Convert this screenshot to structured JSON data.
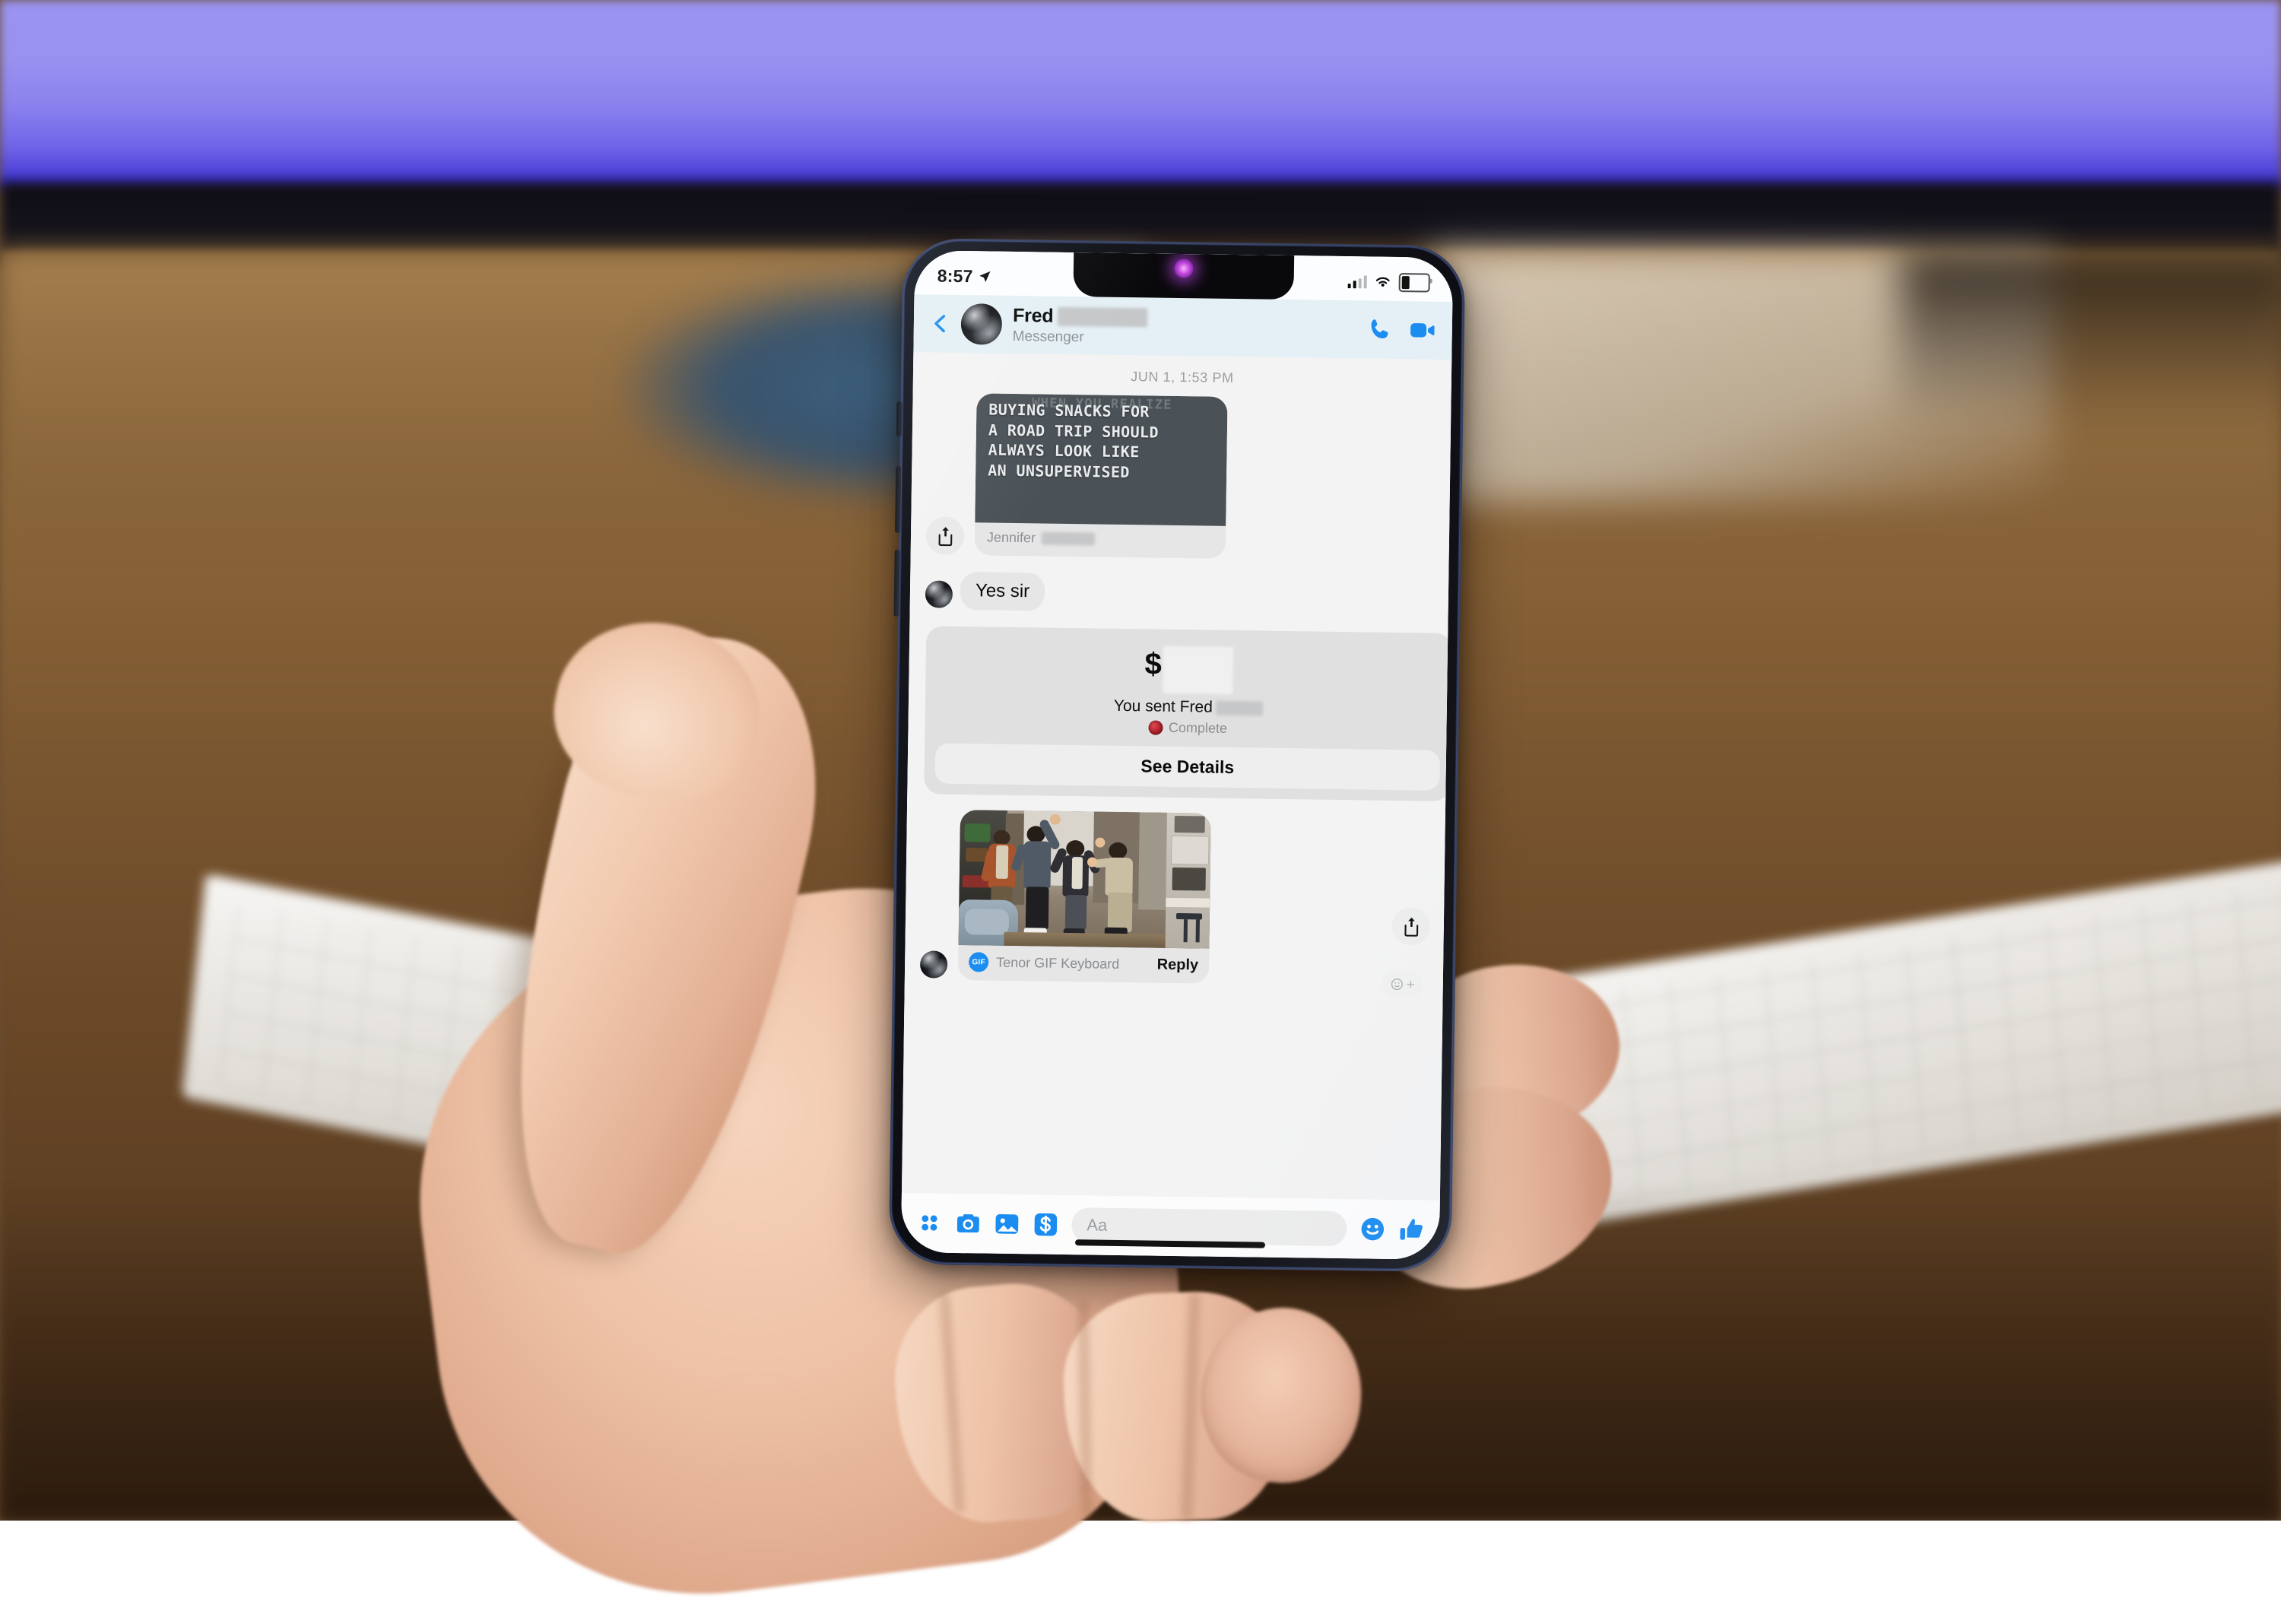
{
  "status_bar": {
    "time": "8:57",
    "location_icon": "location-arrow-icon",
    "signal_icon": "cellular-signal-icon",
    "signal_bars_filled": 2,
    "signal_bars_total": 4,
    "wifi_icon": "wifi-icon",
    "battery_icon": "battery-icon",
    "battery_level_percent": 18
  },
  "header": {
    "back_icon": "back-chevron-icon",
    "avatar_icon": "contact-avatar",
    "contact_name": "Fred",
    "contact_name_redacted": true,
    "subtitle": "Messenger",
    "call_icon": "phone-call-icon",
    "video_icon": "video-call-icon"
  },
  "thread": {
    "date_separator": "JUN 1, 1:53 PM",
    "messages": [
      {
        "type": "meme_attachment",
        "share_icon": "share-icon",
        "clipped_top_line": "WHEN YOU REALIZE",
        "meme_lines": [
          "BUYING SNACKS FOR",
          "A ROAD TRIP SHOULD",
          "ALWAYS LOOK LIKE",
          "AN UNSUPERVISED"
        ],
        "caption_author": "Jennifer",
        "caption_redacted": true
      },
      {
        "type": "text",
        "avatar_icon": "contact-avatar",
        "text": "Yes sir"
      },
      {
        "type": "payment",
        "currency_symbol": "$",
        "amount_redacted": true,
        "sent_label": "You sent Fred",
        "recipient_redacted": true,
        "status_icon": "payment-status-avatar",
        "status_text": "Complete",
        "details_button": "See Details"
      },
      {
        "type": "gif",
        "avatar_icon": "contact-avatar",
        "share_icon": "share-icon",
        "source_badge": "GIF",
        "source_label": "Tenor GIF Keyboard",
        "reply_label": "Reply",
        "reaction_icon": "add-reaction-icon"
      }
    ]
  },
  "composer": {
    "menu_icon": "four-dot-grid-icon",
    "camera_icon": "camera-icon",
    "gallery_icon": "photo-gallery-icon",
    "payment_icon": "payment-dollar-icon",
    "input_placeholder": "Aa",
    "input_value": "",
    "emoji_icon": "emoji-smiley-icon",
    "like_icon": "thumbs-up-icon",
    "home_indicator": "home-indicator-bar"
  },
  "colors": {
    "messenger_blue": "#1b8cf0",
    "header_bg": "#e4f0f5",
    "thread_bg": "#f3f3f3",
    "bubble_gray": "#e6e6e6",
    "meme_bg": "#4b5257",
    "status_red": "#b2222c"
  }
}
